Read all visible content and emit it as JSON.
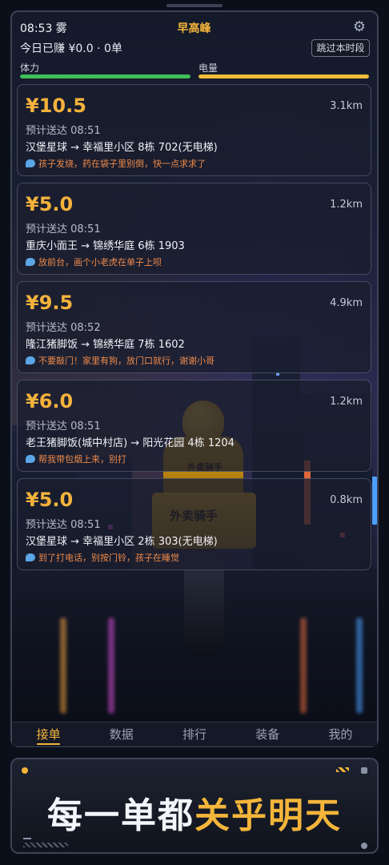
{
  "header": {
    "time_weather": "08:53 雾",
    "period": "早高峰",
    "earnings": "今日已赚 ¥0.0 · 0单",
    "skip_button": "跳过本时段",
    "stamina_label": "体力",
    "battery_label": "电量",
    "stamina_level": 1.0,
    "battery_level": 1.0
  },
  "orders": [
    {
      "price": "¥10.5",
      "distance": "3.1km",
      "eta": "预计送达 08:51",
      "route": "汉堡星球 → 幸福里小区 8栋 702(无电梯)",
      "note": "孩子发烧，药在袋子里别倒，快一点求求了"
    },
    {
      "price": "¥5.0",
      "distance": "1.2km",
      "eta": "预计送达 08:51",
      "route": "重庆小面王 → 锦绣华庭 6栋 1903",
      "note": "放前台，画个小老虎在单子上呗"
    },
    {
      "price": "¥9.5",
      "distance": "4.9km",
      "eta": "预计送达 08:52",
      "route": "隆江猪脚饭 → 锦绣华庭 7栋 1602",
      "note": "不要敲门！家里有狗，放门口就行，谢谢小哥"
    },
    {
      "price": "¥6.0",
      "distance": "1.2km",
      "eta": "预计送达 08:51",
      "route": "老王猪脚饭(城中村店) → 阳光花园 4栋 1204",
      "note": "帮我带包烟上来，别打"
    },
    {
      "price": "¥5.0",
      "distance": "0.8km",
      "eta": "预计送达 08:51",
      "route": "汉堡星球 → 幸福里小区 2栋 303(无电梯)",
      "note": "到了打电话，别按门铃，孩子在睡觉"
    }
  ],
  "tabs": [
    "接单",
    "数据",
    "排行",
    "装备",
    "我的"
  ],
  "active_tab": "接单",
  "background": {
    "jacket_text": "外卖骑手",
    "box_text": "外卖骑手"
  },
  "slogan": {
    "part1": "每一单都",
    "part2": "关乎明天"
  },
  "colors": {
    "accent": "#f3b53a",
    "stamina": "#3fbf5a",
    "battery": "#f0bd3a",
    "note": "#ef8a4a"
  }
}
